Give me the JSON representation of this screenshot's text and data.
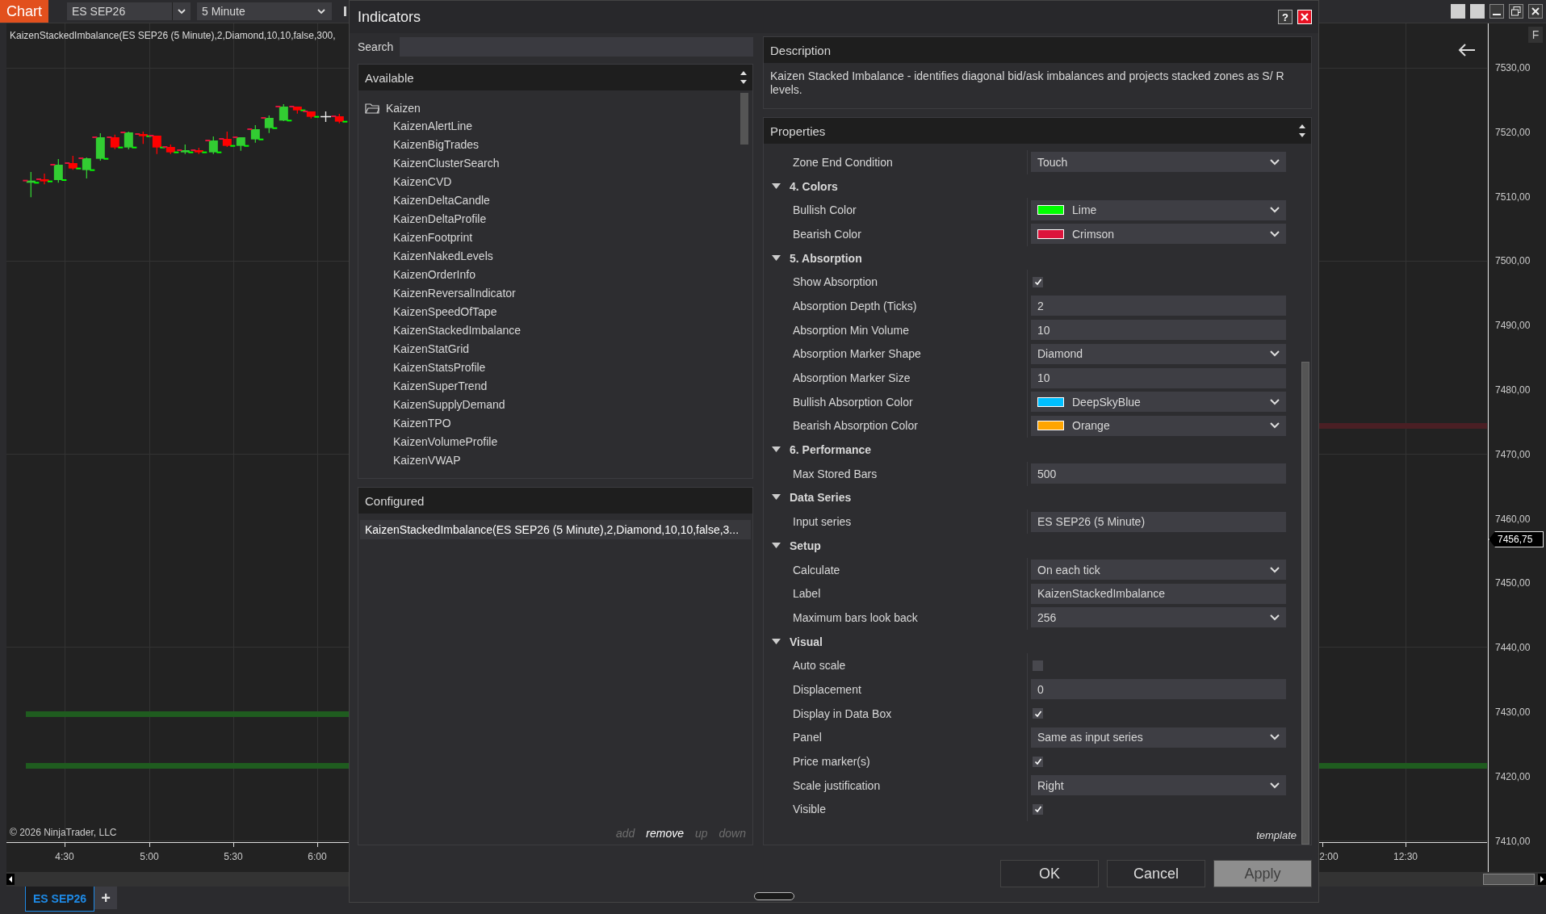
{
  "chart": {
    "tab_label": "Chart",
    "instrument": "ES SEP26",
    "interval": "5 Minute",
    "indicator_label": "KaizenStackedImbalance(ES SEP26 (5 Minute),2,Diamond,10,10,false,300,",
    "copyright": "© 2026 NinjaTrader, LLC",
    "time_labels_left": [
      "4:30",
      "5:00",
      "5:30",
      "6:00"
    ],
    "time_labels_right": [
      "2:00",
      "12:30"
    ],
    "price_labels": [
      "7530,00",
      "7520,00",
      "7510,00",
      "7500,00",
      "7490,00",
      "7480,00",
      "7470,00",
      "7460,00",
      "7450,00",
      "7440,00",
      "7430,00",
      "7420,00",
      "7410,00"
    ],
    "last_price": "7456,75",
    "flip_button": "F",
    "tabs": [
      {
        "label": "ES SEP26",
        "selected": true
      }
    ],
    "add_tab": "+"
  },
  "dialog": {
    "title": "Indicators",
    "help": "?",
    "search_label": "Search",
    "available": {
      "title": "Available",
      "folder": "Kaizen",
      "expanded": true,
      "items": [
        "KaizenAlertLine",
        "KaizenBigTrades",
        "KaizenClusterSearch",
        "KaizenCVD",
        "KaizenDeltaCandle",
        "KaizenDeltaProfile",
        "KaizenFootprint",
        "KaizenNakedLevels",
        "KaizenOrderInfo",
        "KaizenReversalIndicator",
        "KaizenSpeedOfTape",
        "KaizenStackedImbalance",
        "KaizenStatGrid",
        "KaizenStatsProfile",
        "KaizenSuperTrend",
        "KaizenSupplyDemand",
        "KaizenTPO",
        "KaizenVolumeProfile",
        "KaizenVWAP"
      ]
    },
    "configured": {
      "title": "Configured",
      "items": [
        {
          "label": "KaizenStackedImbalance(ES SEP26 (5 Minute),2,Diamond,10,10,false,3...",
          "selected": true
        }
      ]
    },
    "list_actions": [
      {
        "label": "add",
        "disabled": true
      },
      {
        "label": "remove",
        "disabled": false
      },
      {
        "label": "up",
        "disabled": true
      },
      {
        "label": "down",
        "disabled": true
      }
    ],
    "description": {
      "title": "Description",
      "text": "Kaizen Stacked Imbalance - identifies diagonal bid/ask imbalances and projects stacked zones as S/ R levels."
    },
    "properties": {
      "title": "Properties",
      "rows": [
        {
          "kind": "dropdown",
          "label": "Zone End Condition",
          "value": "Touch"
        },
        {
          "kind": "group",
          "label": "4. Colors",
          "expanded": true
        },
        {
          "kind": "color",
          "label": "Bullish Color",
          "value": "Lime",
          "color": "#00ff00"
        },
        {
          "kind": "color",
          "label": "Bearish Color",
          "value": "Crimson",
          "color": "#dc143c"
        },
        {
          "kind": "group",
          "label": "5. Absorption",
          "expanded": true
        },
        {
          "kind": "checkbox",
          "label": "Show Absorption",
          "checked": true
        },
        {
          "kind": "text",
          "label": "Absorption Depth (Ticks)",
          "value": "2"
        },
        {
          "kind": "text",
          "label": "Absorption Min Volume",
          "value": "10"
        },
        {
          "kind": "dropdown",
          "label": "Absorption Marker Shape",
          "value": "Diamond"
        },
        {
          "kind": "text",
          "label": "Absorption Marker Size",
          "value": "10"
        },
        {
          "kind": "color",
          "label": "Bullish Absorption Color",
          "value": "DeepSkyBlue",
          "color": "#00bfff"
        },
        {
          "kind": "color",
          "label": "Bearish Absorption Color",
          "value": "Orange",
          "color": "#ffa500"
        },
        {
          "kind": "group",
          "label": "6. Performance",
          "expanded": true
        },
        {
          "kind": "text",
          "label": "Max Stored Bars",
          "value": "500"
        },
        {
          "kind": "group",
          "label": "Data Series",
          "expanded": true
        },
        {
          "kind": "text",
          "label": "Input series",
          "value": "ES SEP26 (5 Minute)"
        },
        {
          "kind": "group",
          "label": "Setup",
          "expanded": true
        },
        {
          "kind": "dropdown",
          "label": "Calculate",
          "value": "On each tick"
        },
        {
          "kind": "text",
          "label": "Label",
          "value": "KaizenStackedImbalance"
        },
        {
          "kind": "dropdown",
          "label": "Maximum bars look back",
          "value": "256"
        },
        {
          "kind": "group",
          "label": "Visual",
          "expanded": true
        },
        {
          "kind": "checkbox",
          "label": "Auto scale",
          "checked": false
        },
        {
          "kind": "text",
          "label": "Displacement",
          "value": "0"
        },
        {
          "kind": "checkbox",
          "label": "Display in Data Box",
          "checked": true
        },
        {
          "kind": "dropdown",
          "label": "Panel",
          "value": "Same as input series"
        },
        {
          "kind": "checkbox",
          "label": "Price marker(s)",
          "checked": true
        },
        {
          "kind": "dropdown",
          "label": "Scale justification",
          "value": "Right"
        },
        {
          "kind": "checkbox",
          "label": "Visible",
          "checked": true
        }
      ]
    },
    "template_link": "template",
    "buttons": [
      {
        "label": "OK",
        "disabled": false
      },
      {
        "label": "Cancel",
        "disabled": false
      },
      {
        "label": "Apply",
        "disabled": true
      }
    ]
  }
}
